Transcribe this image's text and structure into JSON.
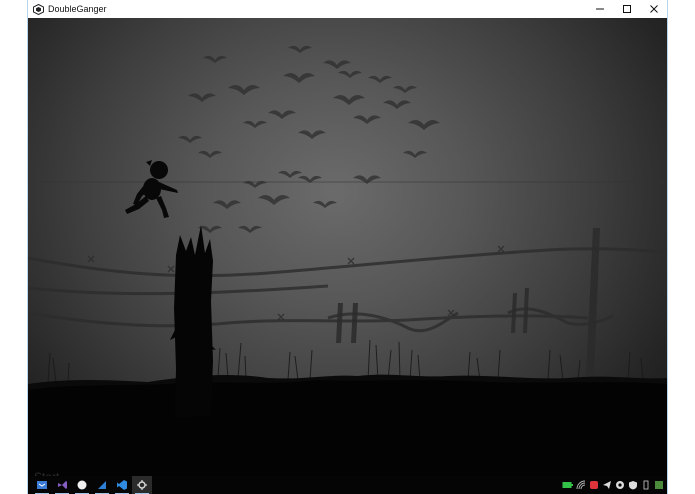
{
  "window": {
    "title": "DoubleGanger",
    "app_icon": "unity-logo-icon",
    "controls": [
      "minimize-icon",
      "maximize-icon",
      "close-icon"
    ]
  },
  "game": {
    "scene": "dark-battlefield",
    "character": "silhouette-boy-running",
    "props": [
      "broken-tree-stump",
      "barbed-wire-fence",
      "fence-post",
      "flock-of-birds",
      "grass"
    ]
  },
  "taskbar": {
    "watermark_text": "Start",
    "pinned": [
      {
        "name": "taskbar-app-1",
        "icon": "blue-app-icon",
        "color": "#3a7bd5"
      },
      {
        "name": "taskbar-app-visual-studio",
        "icon": "visual-studio-icon",
        "color": "#865fc5"
      },
      {
        "name": "taskbar-app-3",
        "icon": "white-circle-icon",
        "color": "#f0f0f0"
      },
      {
        "name": "taskbar-app-4",
        "icon": "blue-sail-icon",
        "color": "#2d7fd6"
      },
      {
        "name": "taskbar-app-vscode",
        "icon": "vscode-icon",
        "color": "#2f8ae0"
      },
      {
        "name": "taskbar-app-unity",
        "icon": "unity-icon",
        "color": "#d8d8d8"
      }
    ],
    "tray": [
      {
        "name": "tray-battery",
        "icon": "battery-icon",
        "color": "#33c24a"
      },
      {
        "name": "tray-wifi",
        "icon": "wifi-icon",
        "color": "#bbbbbb"
      },
      {
        "name": "tray-red-app",
        "icon": "red-app-icon",
        "color": "#e0343c"
      },
      {
        "name": "tray-telegram",
        "icon": "telegram-icon",
        "color": "#dddddd"
      },
      {
        "name": "tray-circle",
        "icon": "circle-app-icon",
        "color": "#dddddd"
      },
      {
        "name": "tray-shield",
        "icon": "shield-icon",
        "color": "#dddddd"
      },
      {
        "name": "tray-usb",
        "icon": "usb-icon",
        "color": "#bbbbbb"
      },
      {
        "name": "tray-green",
        "icon": "green-app-icon",
        "color": "#4b8a3a"
      }
    ]
  }
}
